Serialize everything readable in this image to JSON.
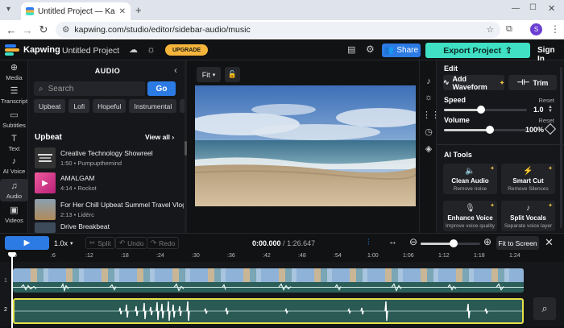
{
  "browser": {
    "tab_title": "Untitled Project — Kapwing",
    "url": "kapwing.com/studio/editor/sidebar-audio/music",
    "profile_initial": "S"
  },
  "topbar": {
    "brand": "Kapwing",
    "project_name": "Untitled Project",
    "upgrade_label": "UPGRADE",
    "share_label": "Share",
    "export_label": "Export Project",
    "signin_label": "Sign In"
  },
  "rail": [
    {
      "label": "Media",
      "icon": "plus-icon"
    },
    {
      "label": "Transcript",
      "icon": "transcript-icon"
    },
    {
      "label": "Subtitles",
      "icon": "subtitles-icon"
    },
    {
      "label": "Text",
      "icon": "text-icon"
    },
    {
      "label": "AI Voice",
      "icon": "voice-icon"
    },
    {
      "label": "Audio",
      "icon": "music-note-icon"
    },
    {
      "label": "Videos",
      "icon": "video-icon"
    }
  ],
  "audio_panel": {
    "title": "AUDIO",
    "search_placeholder": "Search",
    "go_label": "Go",
    "chips": [
      "Upbeat",
      "Lofi",
      "Hopeful",
      "Instrumental",
      "F"
    ],
    "section_title": "Upbeat",
    "view_all": "View all ›",
    "tracks": [
      {
        "name": "Creative Technology Showreel",
        "meta": "1:50 • Pumpupthemind",
        "thumb": "#3a3a3a"
      },
      {
        "name": "AMALGAM",
        "meta": "4:14 • Rockot",
        "thumb": "#e0408a"
      },
      {
        "name": "For Her Chill Upbeat Summel Travel Vlog and",
        "meta": "2:13 • Lidérc",
        "thumb": "#9a7a55"
      },
      {
        "name": "Drive Breakbeat",
        "meta": "",
        "thumb": "#445566"
      }
    ]
  },
  "stage": {
    "fit_label": "Fit"
  },
  "edit_panel": {
    "heading": "Edit",
    "add_waveform": "Add Waveform",
    "trim": "Trim",
    "speed_label": "Speed",
    "speed_reset": "Reset",
    "speed_value": "1.0",
    "speed_level": 0.45,
    "volume_label": "Volume",
    "volume_reset": "Reset",
    "volume_value": "100%",
    "volume_level": 0.55,
    "ai_tools_heading": "AI Tools",
    "ai_tools": [
      {
        "name": "Clean Audio",
        "sub": "Remove noise"
      },
      {
        "name": "Smart Cut",
        "sub": "Remove Silences"
      },
      {
        "name": "Enhance Voice",
        "sub": "Improve voice quality"
      },
      {
        "name": "Split Vocals",
        "sub": "Separate voice layer"
      }
    ]
  },
  "timeline": {
    "speed": "1.0x",
    "split": "Split",
    "undo": "Undo",
    "redo": "Redo",
    "current_time": "0:00.000",
    "duration": "1:26.647",
    "fit_to_screen": "Fit to Screen",
    "zoom_level": 0.55,
    "ticks": [
      "0",
      ":6",
      ":12",
      ":18",
      ":24",
      ":30",
      ":36",
      ":42",
      ":48",
      ":54",
      "1:00",
      "1:06",
      "1:12",
      "1:18",
      "1:24"
    ],
    "track_numbers": [
      "1",
      "2"
    ]
  },
  "colors": {
    "accent_blue": "#2c7be5",
    "export_teal": "#3fe0c4",
    "upgrade_yellow": "#f5b53b",
    "selected_clip_border": "#e6e24a"
  }
}
